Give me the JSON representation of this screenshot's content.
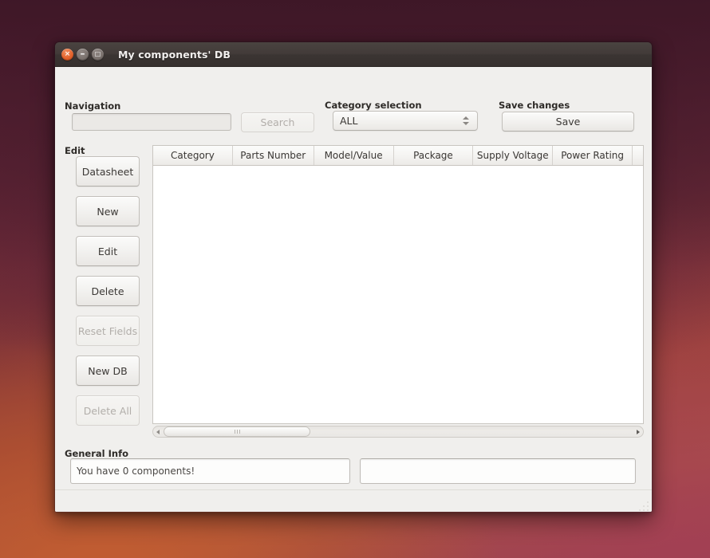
{
  "window": {
    "title": "My components' DB",
    "buttons": {
      "close": "×",
      "minimize": "–",
      "maximize": "□"
    }
  },
  "navigation": {
    "label": "Navigation",
    "search_value": "",
    "search_placeholder": "",
    "search_button": "Search",
    "search_button_enabled": false
  },
  "category": {
    "label": "Category selection",
    "selected": "ALL",
    "options": [
      "ALL"
    ]
  },
  "save": {
    "label": "Save changes",
    "button": "Save"
  },
  "edit": {
    "label": "Edit",
    "buttons": [
      {
        "label": "Datasheet",
        "enabled": true
      },
      {
        "label": "New",
        "enabled": true
      },
      {
        "label": "Edit",
        "enabled": true
      },
      {
        "label": "Delete",
        "enabled": true
      },
      {
        "label": "Reset Fields",
        "enabled": false
      },
      {
        "label": "New DB",
        "enabled": true
      },
      {
        "label": "Delete All",
        "enabled": false
      }
    ]
  },
  "table": {
    "columns": [
      "Category",
      "Parts Number",
      "Model/Value",
      "Package",
      "Supply Voltage",
      "Power Rating",
      ""
    ],
    "rows": []
  },
  "general_info": {
    "label": "General Info",
    "field_left": "You have 0 components!",
    "field_right": ""
  }
}
